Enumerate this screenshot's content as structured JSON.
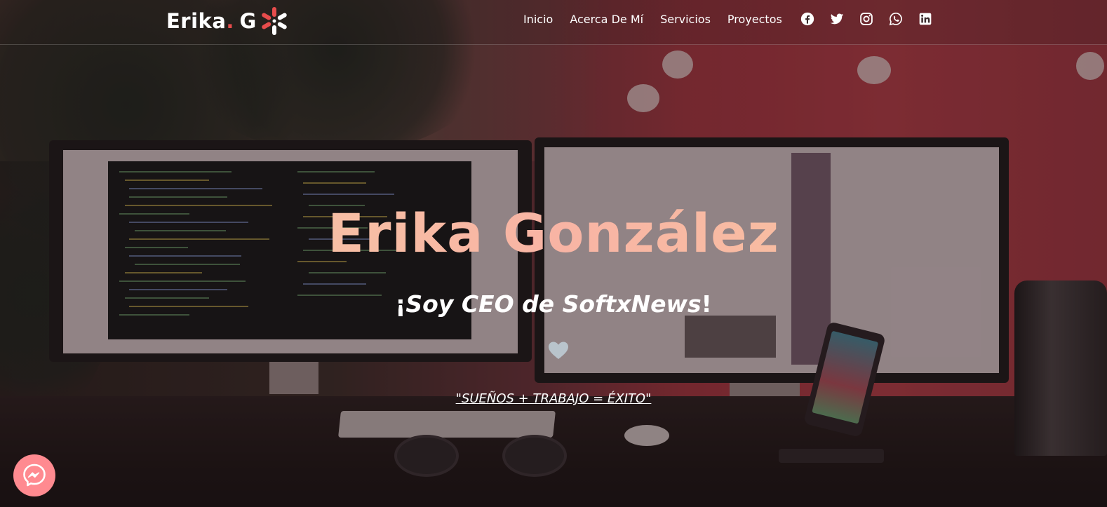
{
  "brand": {
    "name": "Erika",
    "dot": ".",
    "initial": "G",
    "logo_icon": "asterisk-flower-icon",
    "accent_color": "#e74c4c"
  },
  "nav": {
    "links": [
      {
        "label": "Inicio"
      },
      {
        "label": "Acerca De Mí"
      },
      {
        "label": "Servicios"
      },
      {
        "label": "Proyectos"
      }
    ],
    "social": [
      {
        "icon": "facebook-icon"
      },
      {
        "icon": "twitter-icon"
      },
      {
        "icon": "instagram-icon"
      },
      {
        "icon": "whatsapp-icon"
      },
      {
        "icon": "linkedin-icon"
      }
    ]
  },
  "hero": {
    "title": "Erika González",
    "subtitle_prefix": "¡",
    "subtitle_main": "Soy CEO de SoftxNews",
    "subtitle_suffix": "!",
    "heart_icon": "heart-icon",
    "heart_color": "#b9c4cc",
    "motto": "\"SUEÑOS + TRABAJO = ÉXITO\"",
    "title_gradient": [
      "#f6cfa6",
      "#f8b4a4",
      "#f9c8a0"
    ]
  },
  "messenger": {
    "icon": "messenger-icon",
    "color": "#ff8a90"
  }
}
